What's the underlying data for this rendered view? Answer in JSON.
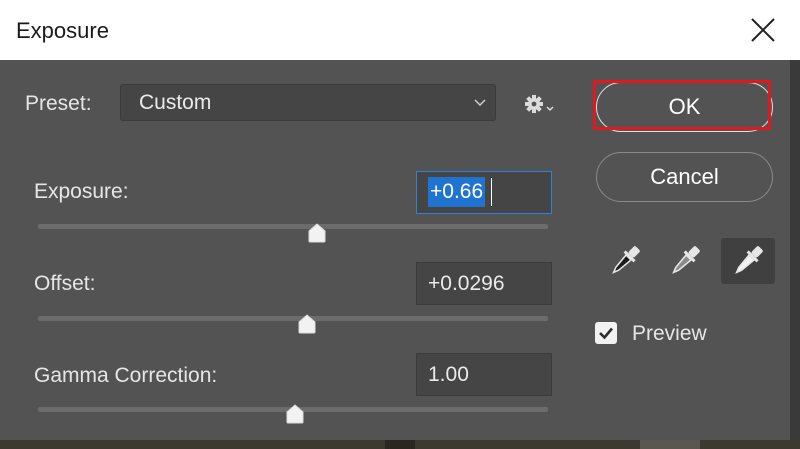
{
  "window": {
    "title": "Exposure"
  },
  "preset": {
    "label": "Preset:",
    "value": "Custom"
  },
  "sliders": [
    {
      "label": "Exposure:",
      "value": "+0.66",
      "level": 0.55
    },
    {
      "label": "Offset:",
      "value": "+0.0296",
      "level": 0.53
    },
    {
      "label": "Gamma Correction:",
      "value": "1.00",
      "level": 0.5
    }
  ],
  "buttons": {
    "ok": "OK",
    "cancel": "Cancel"
  },
  "eyedroppers": [
    "black-point-eyedropper-icon",
    "gray-point-eyedropper-icon",
    "white-point-eyedropper-icon"
  ],
  "preview": {
    "label": "Preview",
    "checked": true
  },
  "colors": {
    "highlight": "#e0191f",
    "selection": "#1f74d1",
    "panel": "#535353"
  }
}
